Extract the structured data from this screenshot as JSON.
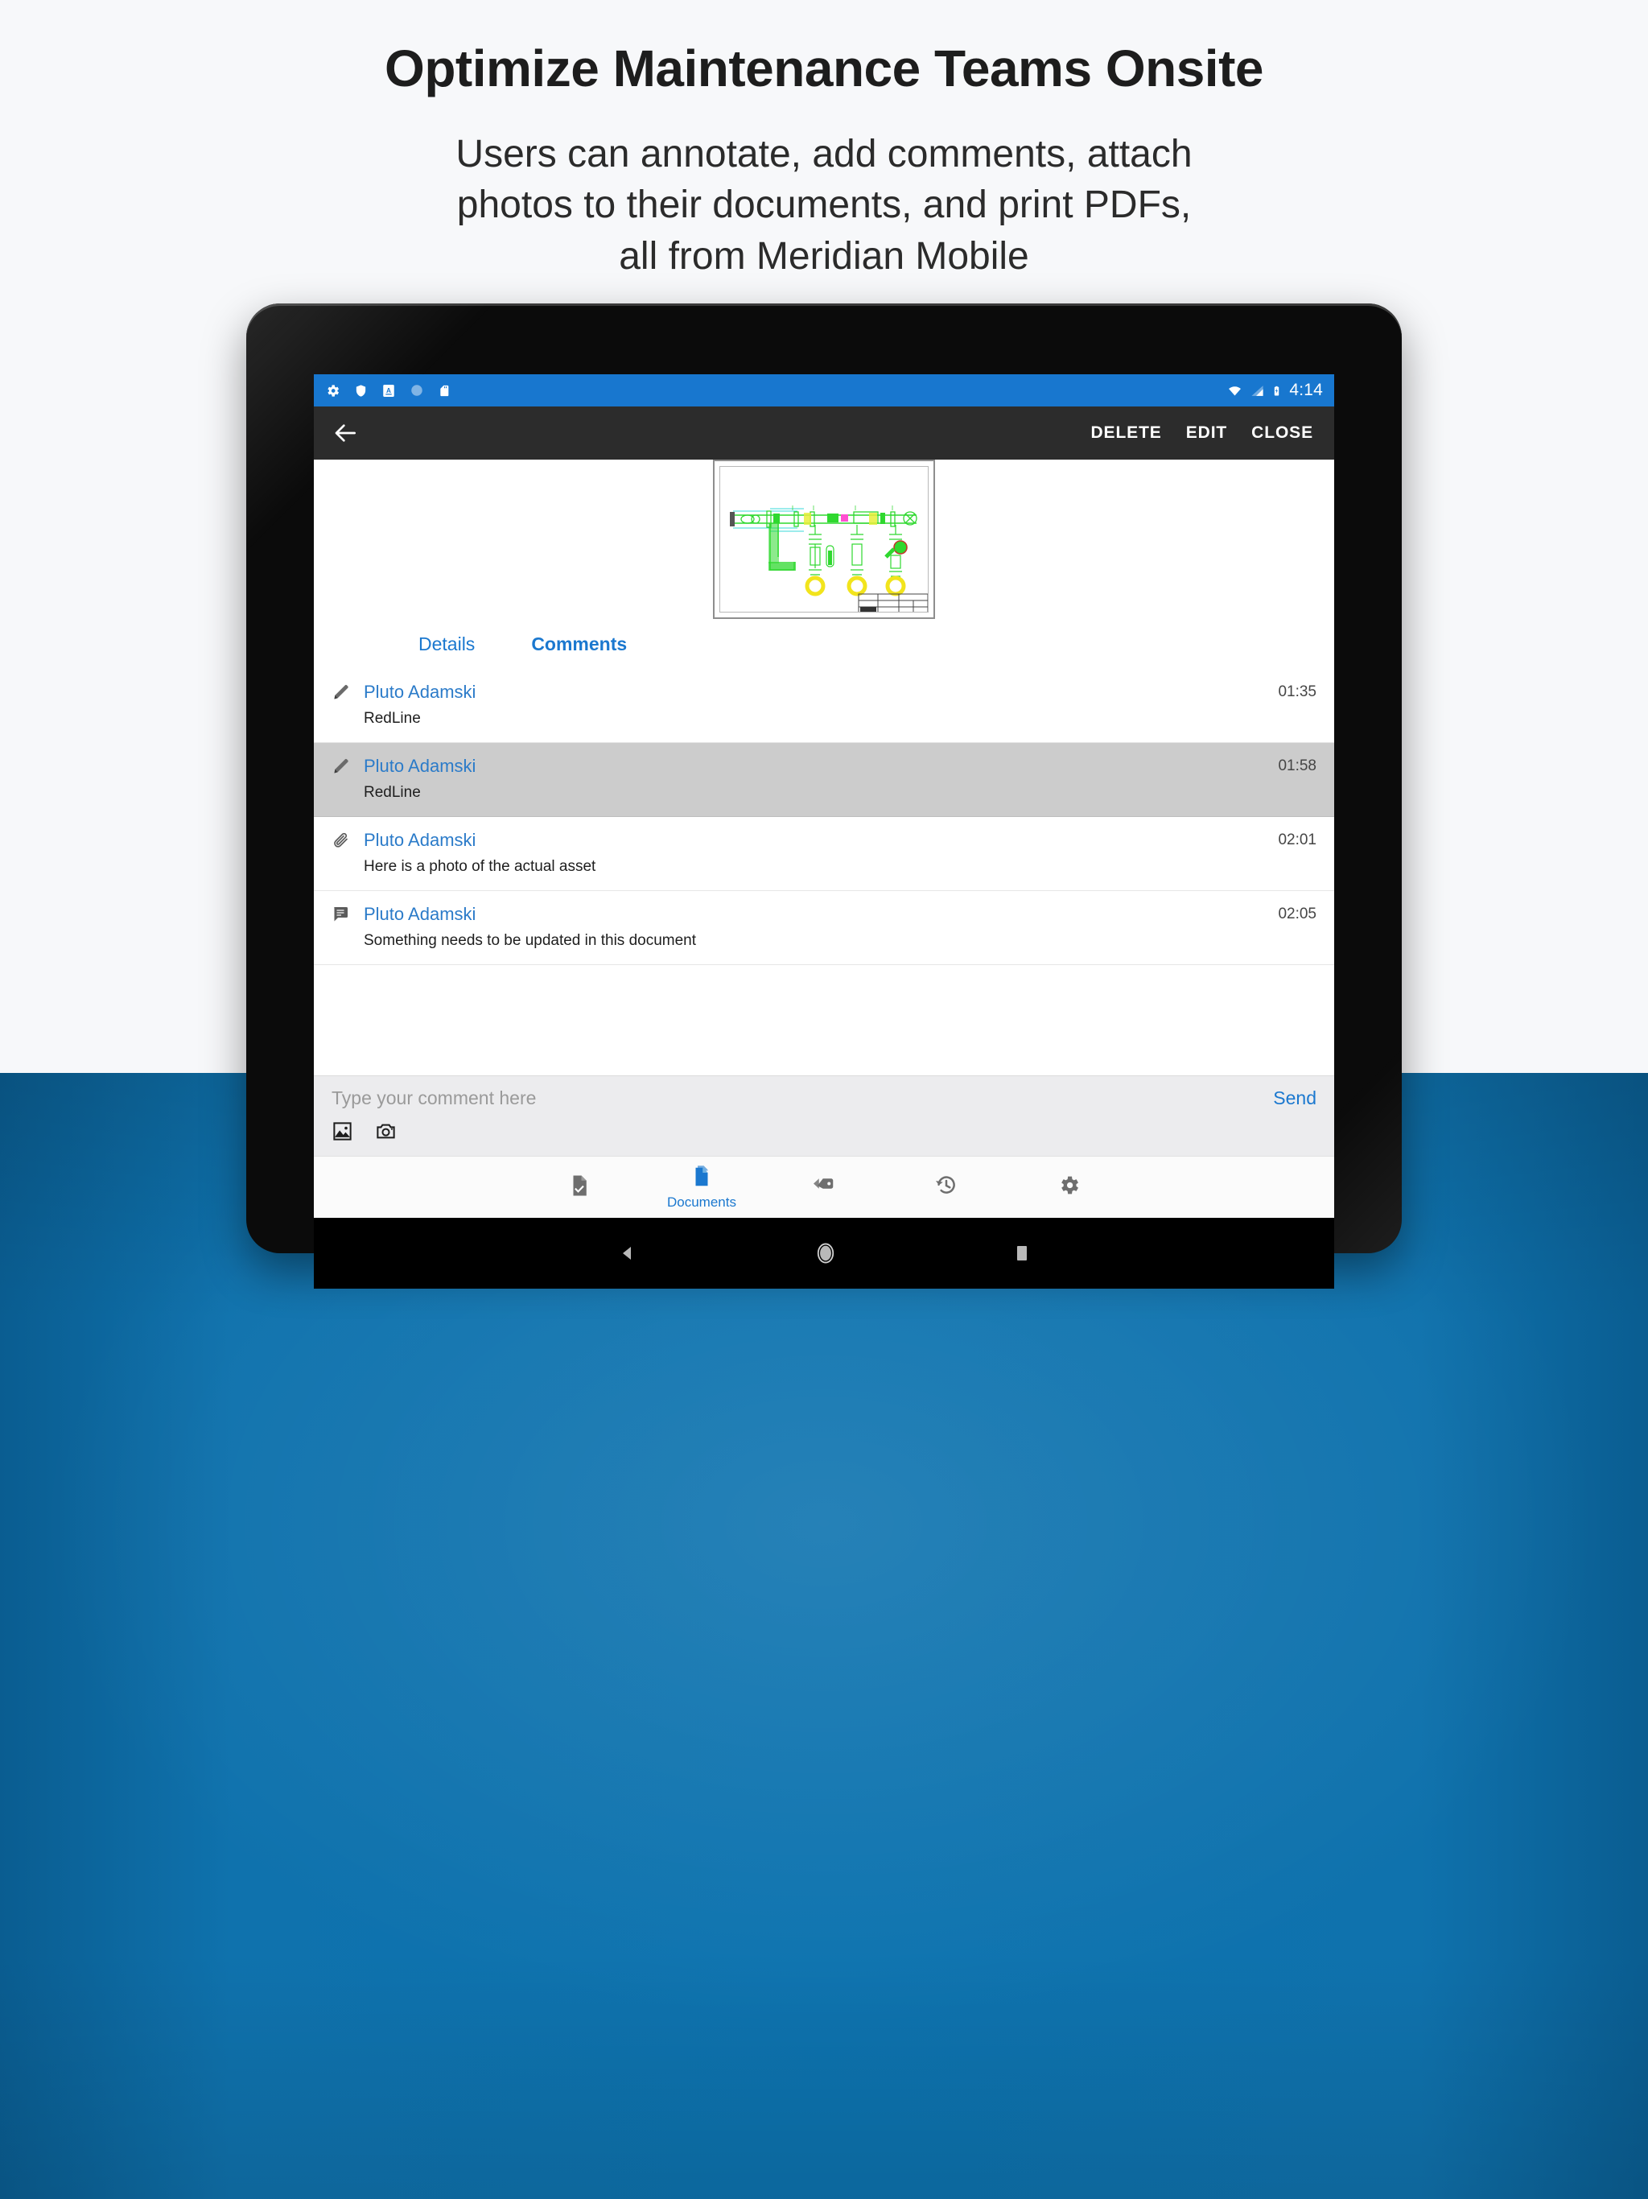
{
  "header": {
    "title": "Optimize Maintenance Teams Onsite",
    "subtitle_lines": [
      "Users can annotate, add comments, attach",
      "photos to their documents, and print PDFs,",
      "all from Meridian Mobile"
    ]
  },
  "colors": {
    "brand_blue": "#0d73af",
    "status_bar_blue": "#1877cf",
    "toolbar_dark": "#2c2c2c",
    "link_blue": "#1b78cf",
    "author_blue": "#2b7bc9",
    "selected_row": "#cccccc",
    "composer_bg": "#ececee"
  },
  "status_bar": {
    "left_icons": [
      "gear-icon",
      "shield-icon",
      "app-badge-a-icon",
      "circle-icon",
      "sd-card-icon"
    ],
    "right_icons": [
      "wifi-icon",
      "cell-signal-icon",
      "battery-charging-icon"
    ],
    "time": "4:14"
  },
  "toolbar": {
    "back_icon": "back-arrow-icon",
    "actions": [
      "DELETE",
      "EDIT",
      "CLOSE"
    ]
  },
  "document_preview": {
    "name": "cad-drawing-thumbnail"
  },
  "tabs": [
    {
      "label": "Details",
      "active": false
    },
    {
      "label": "Comments",
      "active": true
    }
  ],
  "comments": [
    {
      "icon": "redline-pen-icon",
      "author": "Pluto Adamski",
      "time": "01:35",
      "text": "RedLine",
      "selected": false
    },
    {
      "icon": "redline-pen-icon",
      "author": "Pluto Adamski",
      "time": "01:58",
      "text": "RedLine",
      "selected": true
    },
    {
      "icon": "paperclip-icon",
      "author": "Pluto Adamski",
      "time": "02:01",
      "text": "Here is a photo of the actual asset",
      "selected": false
    },
    {
      "icon": "speech-bubble-icon",
      "author": "Pluto Adamski",
      "time": "02:05",
      "text": "Something needs to be updated in this document",
      "selected": false
    }
  ],
  "composer": {
    "placeholder": "Type your comment here",
    "value": "",
    "send_label": "Send",
    "actions": [
      "gallery-image-icon",
      "camera-icon"
    ]
  },
  "bottom_nav": [
    {
      "icon": "task-document-icon",
      "label": "",
      "active": false
    },
    {
      "icon": "documents-icon",
      "label": "Documents",
      "active": true
    },
    {
      "icon": "tag-icon",
      "label": "",
      "active": false
    },
    {
      "icon": "history-icon",
      "label": "",
      "active": false
    },
    {
      "icon": "settings-gear-icon",
      "label": "",
      "active": false
    }
  ],
  "android_nav": {
    "buttons": [
      "back-triangle-icon",
      "home-circle-icon",
      "recents-square-icon"
    ]
  }
}
